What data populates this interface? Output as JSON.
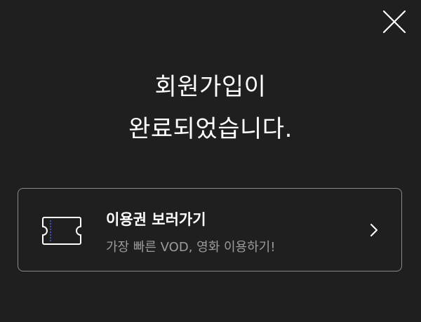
{
  "dialog": {
    "close_icon": "close-icon",
    "headline_line1": "회원가입이",
    "headline_line2": "완료되었습니다."
  },
  "ticket_card": {
    "icon": "ticket-icon",
    "title": "이용권 보러가기",
    "subtitle": "가장 빠른 VOD, 영화 이용하기!",
    "chevron_icon": "chevron-right-icon"
  },
  "colors": {
    "background": "#1f1f1f",
    "text_primary": "#ffffff",
    "text_secondary": "#9c9c9c",
    "card_border": "#8a8a8a",
    "ticket_dots": "#3b4fd6"
  }
}
